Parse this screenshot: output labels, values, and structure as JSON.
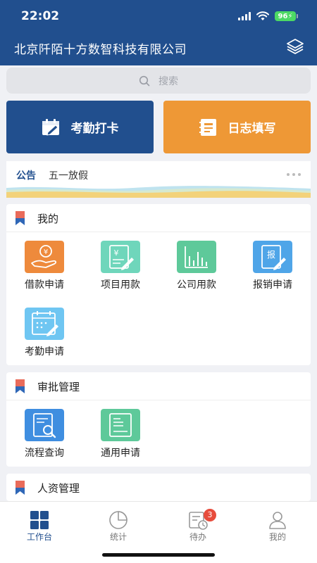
{
  "status": {
    "time": "22:02",
    "battery": "96"
  },
  "header": {
    "company": "北京阡陌十方数智科技有限公司"
  },
  "search": {
    "placeholder": "搜索"
  },
  "actions": [
    {
      "label": "考勤打卡",
      "icon": "calendar-edit-icon",
      "color": "#214f8e"
    },
    {
      "label": "日志填写",
      "icon": "notebook-icon",
      "color": "#ee9836"
    }
  ],
  "notice": {
    "tag": "公告",
    "text": "五一放假"
  },
  "sections": [
    {
      "title": "我的",
      "apps": [
        {
          "label": "借款申请",
          "icon": "loan-hand-icon",
          "color": "#ee8a3c"
        },
        {
          "label": "项目用款",
          "icon": "yen-document-icon",
          "color": "#6fd6bb"
        },
        {
          "label": "公司用款",
          "icon": "bar-chart-icon",
          "color": "#5ec99a"
        },
        {
          "label": "报销申请",
          "icon": "reimbursement-icon",
          "color": "#4fa5e8"
        },
        {
          "label": "考勤申请",
          "icon": "calendar-icon",
          "color": "#6fc6f2"
        }
      ]
    },
    {
      "title": "审批管理",
      "apps": [
        {
          "label": "流程查询",
          "icon": "document-search-icon",
          "color": "#3f8ee0"
        },
        {
          "label": "通用申请",
          "icon": "form-icon",
          "color": "#5ec99a"
        }
      ]
    },
    {
      "title": "人资管理",
      "apps": []
    }
  ],
  "tabs": [
    {
      "label": "工作台",
      "icon": "grid-icon",
      "active": true
    },
    {
      "label": "统计",
      "icon": "pie-chart-icon",
      "active": false
    },
    {
      "label": "待办",
      "icon": "todo-clock-icon",
      "active": false,
      "badge": "3"
    },
    {
      "label": "我的",
      "icon": "user-icon",
      "active": false
    }
  ],
  "colors": {
    "brand": "#214f8e",
    "accent": "#ee9836",
    "badge": "#e74c3c"
  }
}
